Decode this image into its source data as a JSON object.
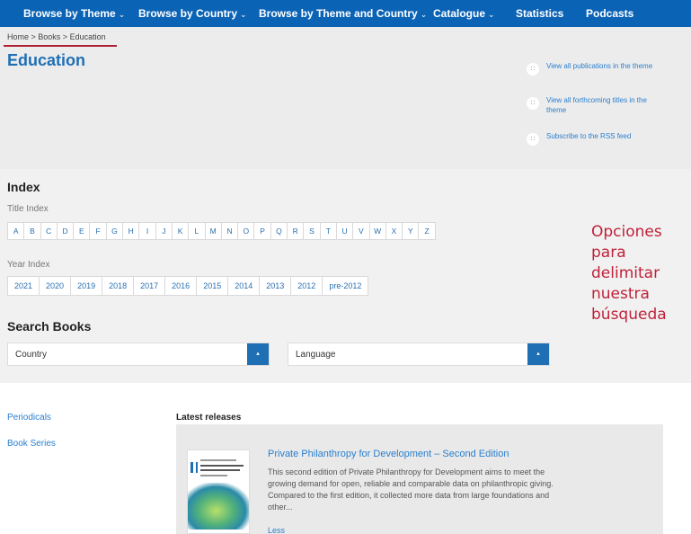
{
  "nav": [
    {
      "label": "Browse by Theme",
      "chevron": "⌄"
    },
    {
      "label": "Browse by Country",
      "chevron": "⌄"
    },
    {
      "label": "Browse by Theme and Country",
      "chevron": "⌄"
    },
    {
      "label": "Catalogue",
      "chevron": "⌄"
    },
    {
      "label": "Statistics",
      "chevron": ""
    },
    {
      "label": "Podcasts",
      "chevron": ""
    }
  ],
  "breadcrumb": {
    "home": "Home",
    "sep1": " > ",
    "books": "Books",
    "sep2": " > ",
    "current": "Education"
  },
  "page_title": "Education",
  "rss_links": [
    {
      "text": "View all publications in the theme"
    },
    {
      "text": "View all forthcoming titles in the theme"
    },
    {
      "text": "Subscribe to the RSS feed"
    }
  ],
  "index": {
    "title": "Index",
    "title_index_label": "Title Index",
    "letters": [
      "A",
      "B",
      "C",
      "D",
      "E",
      "F",
      "G",
      "H",
      "I",
      "J",
      "K",
      "L",
      "M",
      "N",
      "O",
      "P",
      "Q",
      "R",
      "S",
      "T",
      "U",
      "V",
      "W",
      "X",
      "Y",
      "Z"
    ],
    "year_index_label": "Year Index",
    "years": [
      "2021",
      "2020",
      "2019",
      "2018",
      "2017",
      "2016",
      "2015",
      "2014",
      "2013",
      "2012",
      "pre-2012"
    ]
  },
  "annotation": "Opciones para delimitar nuestra búsqueda",
  "search": {
    "title": "Search Books",
    "country": "Country",
    "language": "Language"
  },
  "sidebar": {
    "periodicals": "Periodicals",
    "book_series": "Book Series"
  },
  "latest": {
    "title": "Latest releases",
    "release_title": "Private Philanthropy for Development – Second Edition",
    "release_desc": "This second edition of Private Philanthropy for Development aims to meet the growing demand for open, reliable and comparable data on philanthropic giving. Compared to the first edition, it collected more data from large foundations and other...",
    "less": "Less"
  },
  "colors": {
    "nav_bg": "#0b63b6",
    "accent": "#1f6fb5",
    "annotation": "#c0213a"
  }
}
